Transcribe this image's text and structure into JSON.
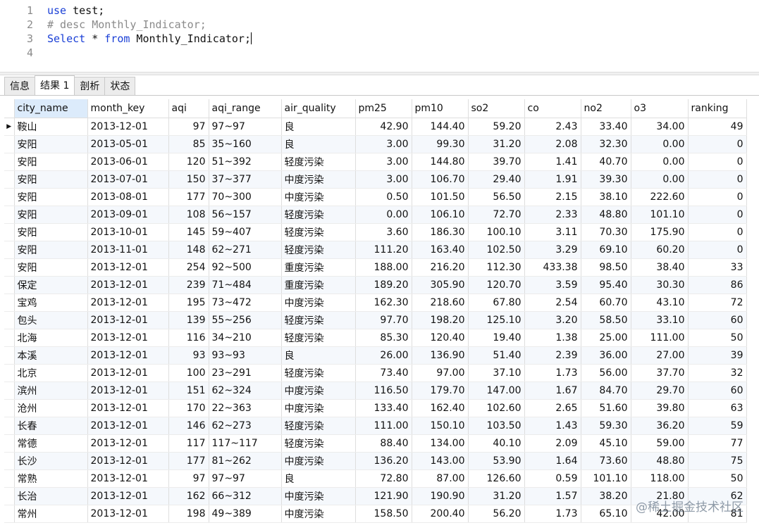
{
  "editor": {
    "lines": [
      {
        "num": "1",
        "parts": [
          {
            "cls": "kw",
            "text": "use"
          },
          {
            "cls": "tx",
            "text": " test;"
          }
        ]
      },
      {
        "num": "2",
        "parts": [
          {
            "cls": "cm",
            "text": "# desc Monthly_Indicator;"
          }
        ]
      },
      {
        "num": "3",
        "parts": [
          {
            "cls": "kw",
            "text": "Select"
          },
          {
            "cls": "tx",
            "text": " * "
          },
          {
            "cls": "kw",
            "text": "from"
          },
          {
            "cls": "tx",
            "text": " Monthly_Indicator;"
          }
        ]
      },
      {
        "num": "4",
        "parts": []
      }
    ]
  },
  "tabs": [
    {
      "label": "信息",
      "name": "tab-info",
      "active": false
    },
    {
      "label": "结果 1",
      "name": "tab-result-1",
      "active": true
    },
    {
      "label": "剖析",
      "name": "tab-profile",
      "active": false
    },
    {
      "label": "状态",
      "name": "tab-status",
      "active": false
    }
  ],
  "table": {
    "columns": [
      "city_name",
      "month_key",
      "aqi",
      "aqi_range",
      "air_quality",
      "pm25",
      "pm10",
      "so2",
      "co",
      "no2",
      "o3",
      "ranking"
    ],
    "rows": [
      [
        "鞍山",
        "2013-12-01",
        "97",
        "97~97",
        "良",
        "42.90",
        "144.40",
        "59.20",
        "2.43",
        "33.40",
        "34.00",
        "49"
      ],
      [
        "安阳",
        "2013-05-01",
        "85",
        "35~160",
        "良",
        "3.00",
        "99.30",
        "31.20",
        "2.08",
        "32.30",
        "0.00",
        "0"
      ],
      [
        "安阳",
        "2013-06-01",
        "120",
        "51~392",
        "轻度污染",
        "3.00",
        "144.80",
        "39.70",
        "1.41",
        "40.70",
        "0.00",
        "0"
      ],
      [
        "安阳",
        "2013-07-01",
        "150",
        "37~377",
        "中度污染",
        "3.00",
        "106.70",
        "29.40",
        "1.91",
        "39.30",
        "0.00",
        "0"
      ],
      [
        "安阳",
        "2013-08-01",
        "177",
        "70~300",
        "中度污染",
        "0.50",
        "101.50",
        "56.50",
        "2.15",
        "38.10",
        "222.60",
        "0"
      ],
      [
        "安阳",
        "2013-09-01",
        "108",
        "56~157",
        "轻度污染",
        "0.00",
        "106.10",
        "72.70",
        "2.33",
        "48.80",
        "101.10",
        "0"
      ],
      [
        "安阳",
        "2013-10-01",
        "145",
        "59~407",
        "轻度污染",
        "3.60",
        "186.30",
        "100.10",
        "3.11",
        "70.30",
        "175.90",
        "0"
      ],
      [
        "安阳",
        "2013-11-01",
        "148",
        "62~271",
        "轻度污染",
        "111.20",
        "163.40",
        "102.50",
        "3.29",
        "69.10",
        "60.20",
        "0"
      ],
      [
        "安阳",
        "2013-12-01",
        "254",
        "92~500",
        "重度污染",
        "188.00",
        "216.20",
        "112.30",
        "433.38",
        "98.50",
        "38.40",
        "33"
      ],
      [
        "保定",
        "2013-12-01",
        "239",
        "71~484",
        "重度污染",
        "189.20",
        "305.90",
        "120.70",
        "3.59",
        "95.40",
        "30.30",
        "86"
      ],
      [
        "宝鸡",
        "2013-12-01",
        "195",
        "73~472",
        "中度污染",
        "162.30",
        "218.60",
        "67.80",
        "2.54",
        "60.70",
        "43.10",
        "72"
      ],
      [
        "包头",
        "2013-12-01",
        "139",
        "55~256",
        "轻度污染",
        "97.70",
        "198.20",
        "125.10",
        "3.20",
        "58.50",
        "33.10",
        "60"
      ],
      [
        "北海",
        "2013-12-01",
        "116",
        "34~210",
        "轻度污染",
        "85.30",
        "120.40",
        "19.40",
        "1.38",
        "25.00",
        "111.00",
        "50"
      ],
      [
        "本溪",
        "2013-12-01",
        "93",
        "93~93",
        "良",
        "26.00",
        "136.90",
        "51.40",
        "2.39",
        "36.00",
        "27.00",
        "39"
      ],
      [
        "北京",
        "2013-12-01",
        "100",
        "23~291",
        "轻度污染",
        "73.40",
        "97.00",
        "37.10",
        "1.73",
        "56.00",
        "37.70",
        "32"
      ],
      [
        "滨州",
        "2013-12-01",
        "151",
        "62~324",
        "中度污染",
        "116.50",
        "179.70",
        "147.00",
        "1.67",
        "84.70",
        "29.70",
        "60"
      ],
      [
        "沧州",
        "2013-12-01",
        "170",
        "22~363",
        "中度污染",
        "133.40",
        "162.40",
        "102.60",
        "2.65",
        "51.60",
        "39.80",
        "63"
      ],
      [
        "长春",
        "2013-12-01",
        "146",
        "62~273",
        "轻度污染",
        "111.00",
        "150.10",
        "103.50",
        "1.43",
        "59.30",
        "36.20",
        "59"
      ],
      [
        "常德",
        "2013-12-01",
        "117",
        "117~117",
        "轻度污染",
        "88.40",
        "134.00",
        "40.10",
        "2.09",
        "45.10",
        "59.00",
        "77"
      ],
      [
        "长沙",
        "2013-12-01",
        "177",
        "81~262",
        "中度污染",
        "136.20",
        "143.00",
        "53.90",
        "1.64",
        "73.60",
        "48.80",
        "75"
      ],
      [
        "常熟",
        "2013-12-01",
        "97",
        "97~97",
        "良",
        "72.80",
        "87.00",
        "126.60",
        "0.59",
        "101.10",
        "118.00",
        "50"
      ],
      [
        "长治",
        "2013-12-01",
        "162",
        "66~312",
        "中度污染",
        "121.90",
        "190.90",
        "31.20",
        "1.57",
        "38.20",
        "21.80",
        "62"
      ],
      [
        "常州",
        "2013-12-01",
        "198",
        "49~389",
        "中度污染",
        "158.50",
        "200.40",
        "56.20",
        "1.73",
        "65.10",
        "42.00",
        "81"
      ]
    ]
  },
  "watermark": "@稀土掘金技术社区"
}
